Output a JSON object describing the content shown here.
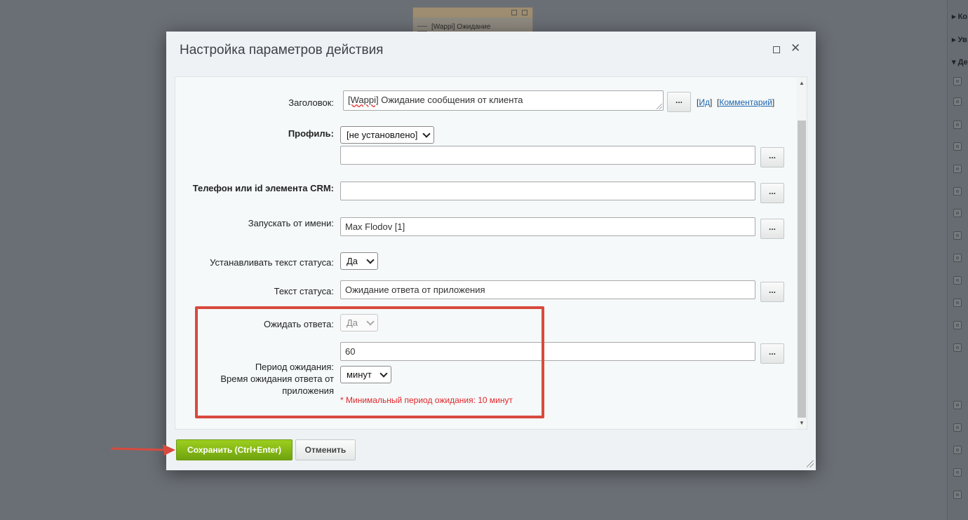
{
  "background": {
    "card_title": "[Wappi] Ожидание",
    "right_panel_sections": [
      "Ко",
      "Ув",
      "Де"
    ]
  },
  "dialog": {
    "title": "Настройка параметров действия",
    "maximize_icon": "maximize-icon",
    "close_icon": "close-icon",
    "close_glyph": "✕"
  },
  "form": {
    "title_label": "Заголовок:",
    "title_prefix": "[Wappi]",
    "title_rest": " Ожидание сообщения от клиента",
    "id_link": "Ид",
    "comment_link": "Комментарий",
    "profile_label": "Профиль:",
    "profile_select": "[не установлено]",
    "profile_value": "",
    "phone_label": "Телефон или id элемента CRM:",
    "phone_value": "",
    "run_as_label": "Запускать от имени:",
    "run_as_value": "Max Flodov [1]",
    "set_status_label": "Устанавливать текст статуса:",
    "set_status_select": "Да",
    "status_text_label": "Текст статуса:",
    "status_text_value": "Ожидание ответа от приложения",
    "wait_reply_label": "Ожидать ответа:",
    "wait_reply_select": "Да",
    "period_label_line1": "Период ожидания:",
    "period_label_line2": "Время ожидания ответа от",
    "period_label_line3": "приложения",
    "period_value": "60",
    "period_unit": "минут",
    "min_period_note": "* Минимальный период ожидания: 10 минут",
    "dots_button": "..."
  },
  "buttons": {
    "save": "Сохранить (Ctrl+Enter)",
    "cancel": "Отменить"
  },
  "colors": {
    "highlight": "#d84a3e",
    "save_button": "#7fb514",
    "link": "#2067b0",
    "error_text": "#e0262b"
  }
}
